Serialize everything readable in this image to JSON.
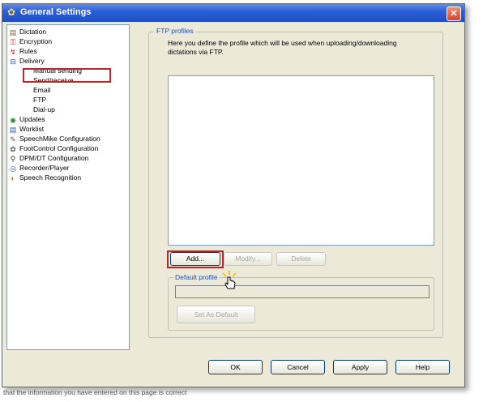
{
  "window": {
    "title": "General Settings",
    "close_label": "✕"
  },
  "tree": {
    "items": [
      {
        "label": "Dictation",
        "icon": "dictation-icon",
        "glyph": "▤",
        "color": "#8b5a2b"
      },
      {
        "label": "Encryption",
        "icon": "encryption-icon",
        "glyph": "⚿",
        "color": "#c03030"
      },
      {
        "label": "Rules",
        "icon": "rules-icon",
        "glyph": "↯",
        "color": "#c03030"
      },
      {
        "label": "Delivery",
        "icon": "delivery-icon",
        "glyph": "⊟",
        "color": "#2a55b5"
      },
      {
        "label": "Manual sending"
      },
      {
        "label": "Send/receive"
      },
      {
        "label": "Email"
      },
      {
        "label": "FTP"
      },
      {
        "label": "Dial-up"
      },
      {
        "label": "Updates",
        "icon": "updates-icon",
        "glyph": "◉",
        "color": "#1f8a2a"
      },
      {
        "label": "Worklist",
        "icon": "worklist-icon",
        "glyph": "▤",
        "color": "#2a55b5"
      },
      {
        "label": "SpeechMike Configuration",
        "icon": "speechmike-icon",
        "glyph": "✎",
        "color": "#555"
      },
      {
        "label": "FootControl Configuration",
        "icon": "footcontrol-icon",
        "glyph": "✿",
        "color": "#555"
      },
      {
        "label": "DPM/DT Configuration",
        "icon": "dpm-icon",
        "glyph": "⚲",
        "color": "#333"
      },
      {
        "label": "Recorder/Player",
        "icon": "recorder-icon",
        "glyph": "◎",
        "color": "#2a55b5"
      },
      {
        "label": "Speech Recognition",
        "icon": "speech-recognition-icon",
        "glyph": "◐",
        "color": "#b08020"
      }
    ]
  },
  "ftp_profiles": {
    "legend": "FTP profiles",
    "description": "Here you define the profile which will be used when uploading/downloading dictations via FTP.",
    "add_label": "Add...",
    "modify_label": "Modify...",
    "delete_label": "Delete"
  },
  "default_profile": {
    "legend": "Default profile",
    "value": "",
    "set_default_label": "Set As Default"
  },
  "footer": {
    "ok_label": "OK",
    "cancel_label": "Cancel",
    "apply_label": "Apply",
    "help_label": "Help"
  },
  "bottom_text": "that the information you have entered on this page is correct"
}
